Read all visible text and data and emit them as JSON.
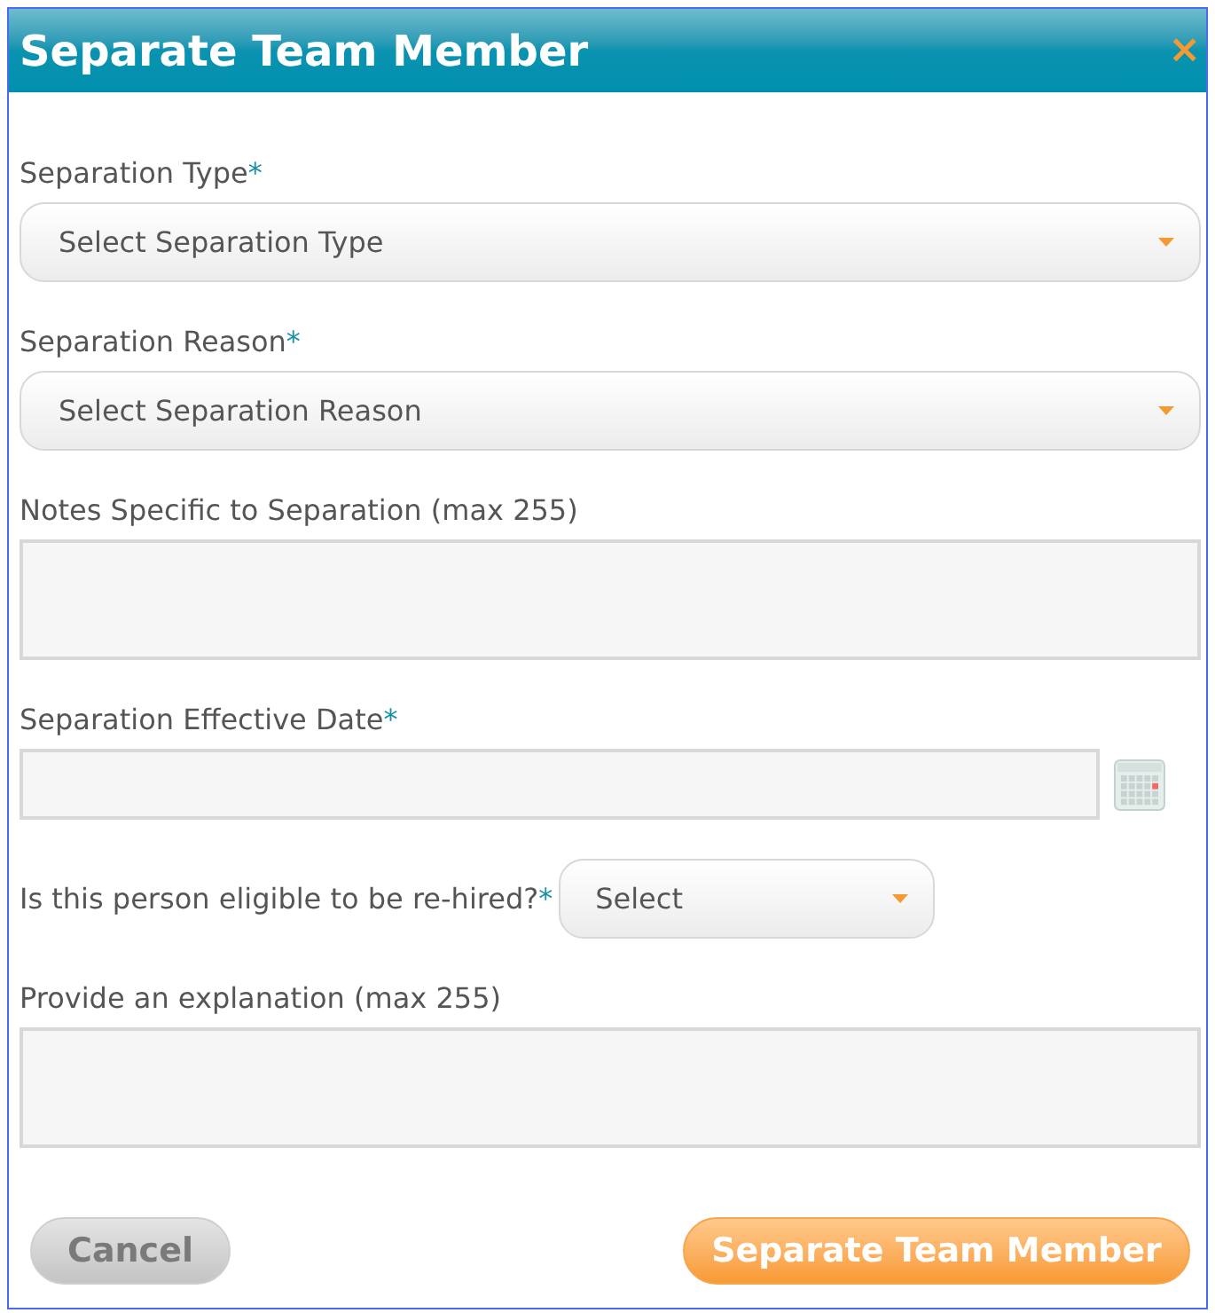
{
  "window": {
    "title": "Separate Team Member",
    "close": "×"
  },
  "fields": [
    {
      "kind": "select",
      "label": "Separation Type",
      "required_mark": "*",
      "placeholder": "Select Separation Type"
    },
    {
      "kind": "select",
      "label": "Separation Reason",
      "required_mark": "*",
      "placeholder": "Select Separation Reason"
    },
    {
      "kind": "textarea",
      "label": "Notes Specific to Separation (max 255)"
    },
    {
      "kind": "date",
      "label": "Separation Effective Date",
      "required_mark": "*"
    },
    {
      "kind": "inline_select",
      "label": "Is this person eligible to be re-hired?",
      "required_mark": "*",
      "placeholder": "Select"
    },
    {
      "kind": "textarea",
      "label": "Provide an explanation (max 255)"
    }
  ],
  "buttons": [
    {
      "kind": "secondary",
      "label": "Cancel"
    },
    {
      "kind": "primary",
      "label": "Separate Team Member"
    }
  ]
}
